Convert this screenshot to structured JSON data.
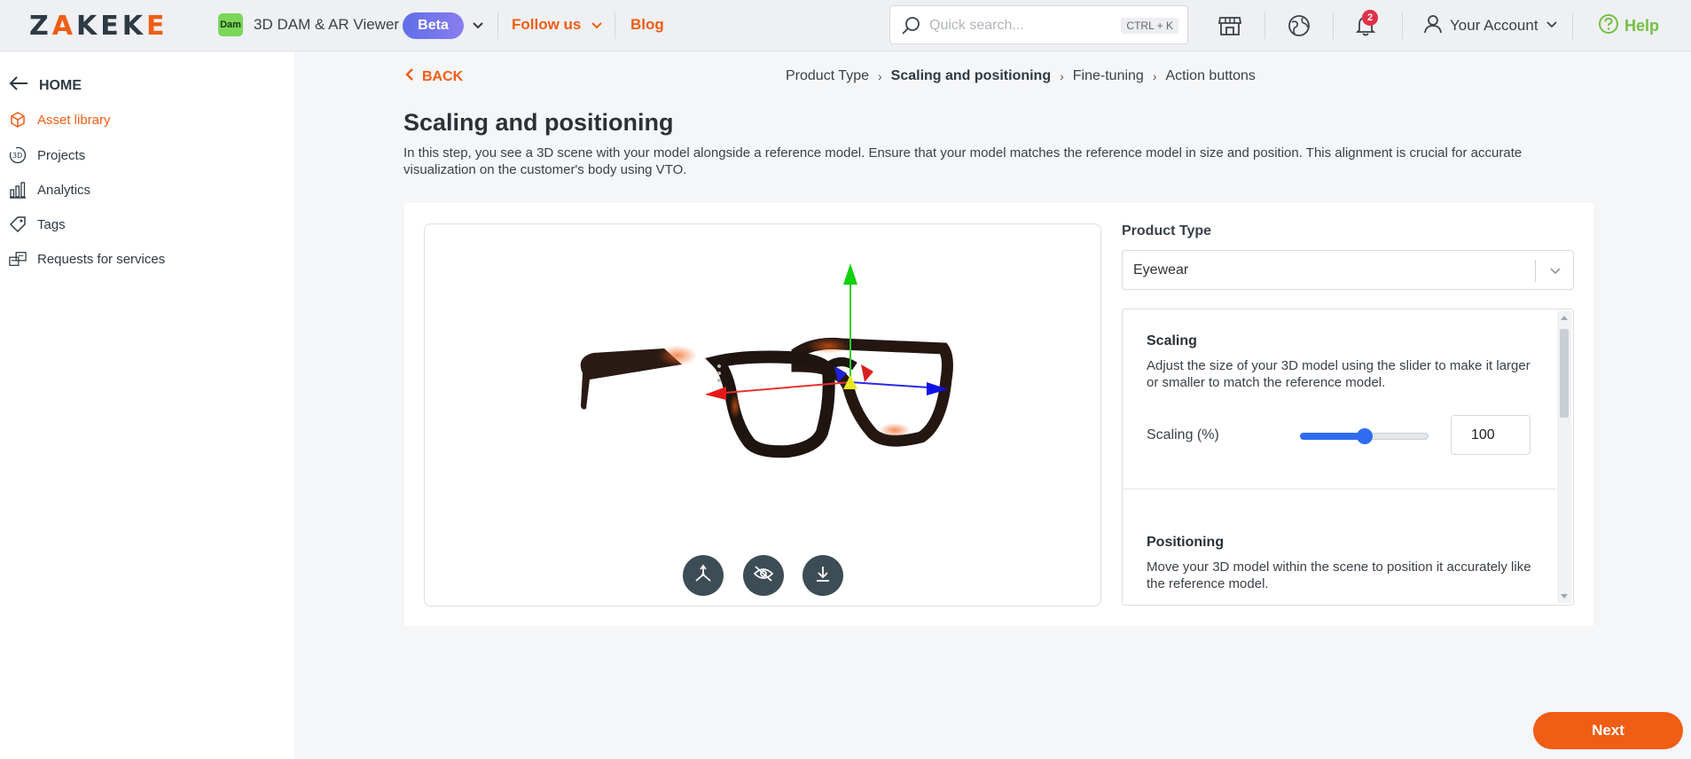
{
  "topbar": {
    "logo_text": "ZAKEKE",
    "app_badge": "Dam",
    "app_name": "3D DAM & AR Viewer",
    "beta_label": "Beta",
    "follow_label": "Follow us",
    "blog_label": "Blog",
    "search_placeholder": "Quick search...",
    "search_shortcut": "CTRL + K",
    "notification_count": "2",
    "account_label": "Your Account",
    "help_label": "Help",
    "icons": [
      "store-icon",
      "globe-icon",
      "bell-icon",
      "user-icon",
      "help-circle-icon"
    ]
  },
  "sidebar": {
    "home_label": "HOME",
    "items": [
      {
        "label": "Asset library",
        "icon": "cube-icon",
        "active": true
      },
      {
        "label": "Projects",
        "icon": "3d-icon",
        "active": false
      },
      {
        "label": "Analytics",
        "icon": "bar-chart-icon",
        "active": false
      },
      {
        "label": "Tags",
        "icon": "tag-icon",
        "active": false
      },
      {
        "label": "Requests for services",
        "icon": "services-icon",
        "active": false
      }
    ]
  },
  "main": {
    "back_label": "BACK",
    "breadcrumbs": [
      {
        "label": "Product Type",
        "current": false
      },
      {
        "label": "Scaling and positioning",
        "current": true
      },
      {
        "label": "Fine-tuning",
        "current": false
      },
      {
        "label": "Action buttons",
        "current": false
      }
    ],
    "title": "Scaling and positioning",
    "description": "In this step, you see a 3D scene with your model alongside a reference model. Ensure that your model matches the reference model in size and position. This alignment is crucial for accurate visualization on the customer's body using VTO.",
    "viewer_buttons": [
      "transform-axes-icon",
      "hide-eye-icon",
      "download-icon"
    ],
    "product_type_label": "Product Type",
    "product_type_value": "Eyewear",
    "scaling": {
      "heading": "Scaling",
      "text": "Adjust the size of your 3D model using the slider to make it larger or smaller to match the reference model.",
      "label": "Scaling (%)",
      "value": "100",
      "slider_fraction": 0.5
    },
    "positioning": {
      "heading": "Positioning",
      "text": "Move your 3D model within the scene to position it accurately like the reference model."
    },
    "next_label": "Next"
  },
  "colors": {
    "accent": "#f05d14",
    "help": "#74c043",
    "slider": "#2f6cf2",
    "viewer_button": "#3d4d55"
  }
}
